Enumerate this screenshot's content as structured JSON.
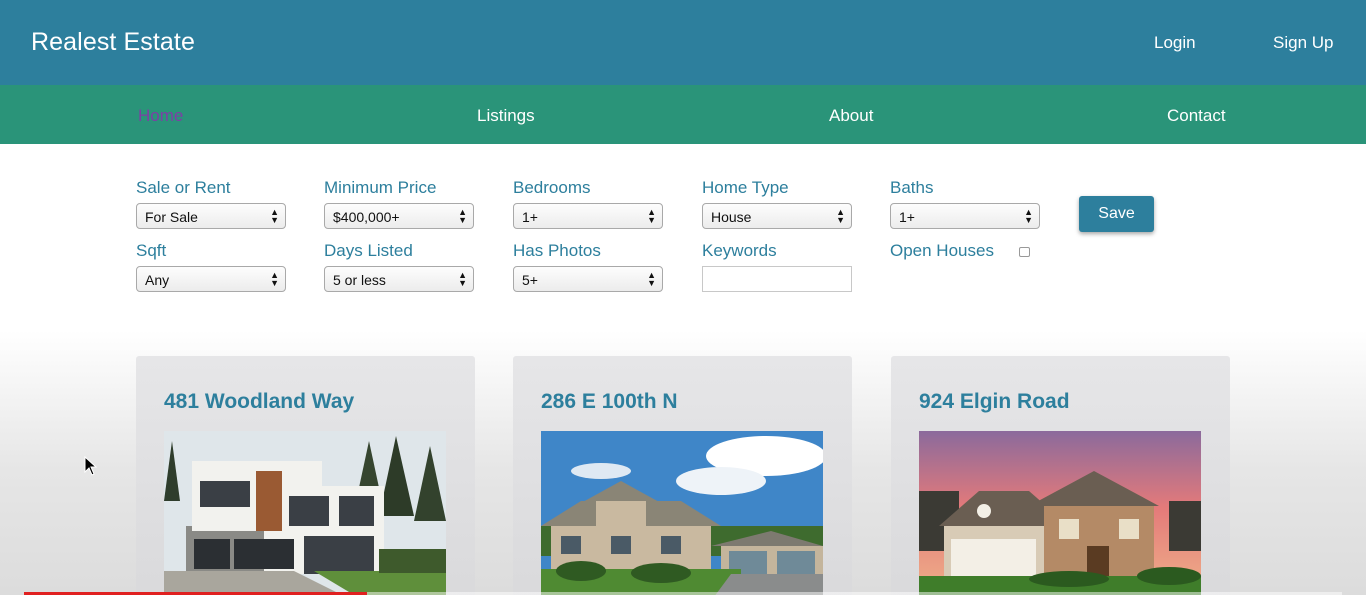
{
  "header": {
    "brand": "Realest Estate",
    "login_label": "Login",
    "signup_label": "Sign Up"
  },
  "nav": {
    "items": [
      {
        "label": "Home",
        "active": true
      },
      {
        "label": "Listings",
        "active": false
      },
      {
        "label": "About",
        "active": false
      },
      {
        "label": "Contact",
        "active": false
      }
    ]
  },
  "filters": {
    "sale_or_rent": {
      "label": "Sale or Rent",
      "value": "For Sale"
    },
    "minimum_price": {
      "label": "Minimum Price",
      "value": "$400,000+"
    },
    "bedrooms": {
      "label": "Bedrooms",
      "value": "1+"
    },
    "home_type": {
      "label": "Home Type",
      "value": "House"
    },
    "baths": {
      "label": "Baths",
      "value": "1+"
    },
    "sqft": {
      "label": "Sqft",
      "value": "Any"
    },
    "days_listed": {
      "label": "Days Listed",
      "value": "5 or less"
    },
    "has_photos": {
      "label": "Has Photos",
      "value": "5+"
    },
    "keywords": {
      "label": "Keywords",
      "value": ""
    },
    "open_houses": {
      "label": "Open Houses",
      "checked": false
    },
    "save_label": "Save"
  },
  "listings": [
    {
      "title": "481 Woodland Way"
    },
    {
      "title": "286 E 100th N"
    },
    {
      "title": "924 Elgin Road"
    }
  ],
  "video_progress": 0.26,
  "colors": {
    "header": "#2d7f9d",
    "nav": "#2a9479",
    "accent": "#2d7f9d",
    "active_nav": "#7d3fa5"
  }
}
